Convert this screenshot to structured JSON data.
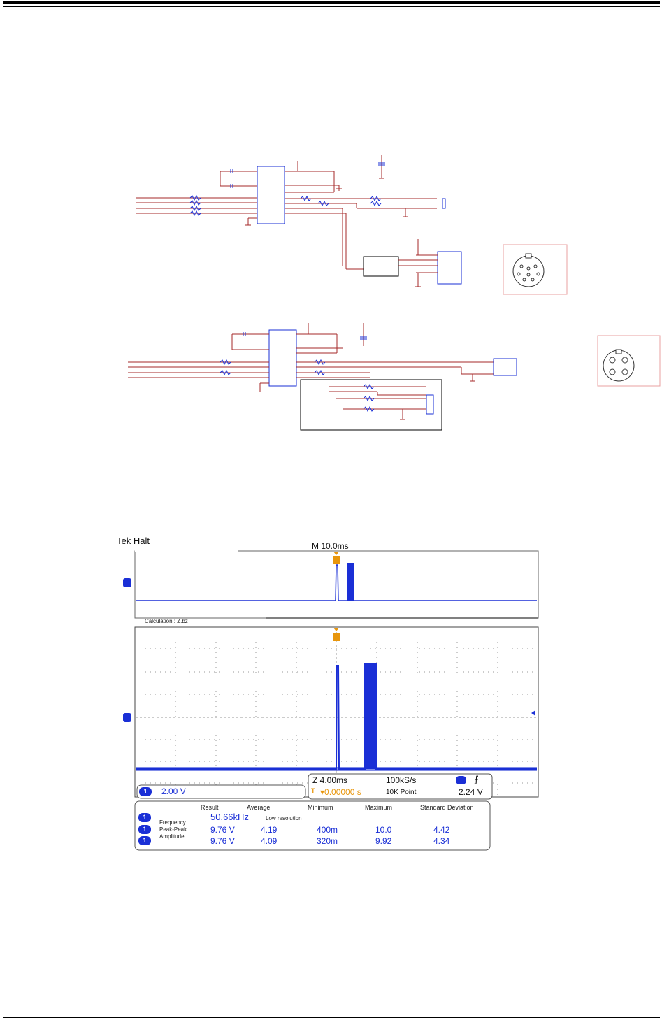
{
  "scope": {
    "brand_status": "Tek Halt",
    "main_timebase": "M 10.0ms",
    "calculation_label": "Calculation : Z.bz",
    "channel_marker": "1",
    "trigger_marker": "T",
    "zoom_timebase": "Z 4.00ms",
    "sample_rate": "100kS/s",
    "trigger_position": "▾0.00000 s",
    "record_length": "10K Point",
    "trigger_level": "2.24 V",
    "trigger_slope_icon": "rising-edge-icon",
    "channel_scale": "2.00 V",
    "colors": {
      "trace": "#1a2fd6",
      "trigger": "#e8960c",
      "schematic": "#b22222"
    }
  },
  "measurements": {
    "headers": [
      "Result",
      "Average",
      "Minimum",
      "Maximum",
      "Standard Deviation"
    ],
    "rows": [
      {
        "name": "Frequency",
        "result": "50.66kHz",
        "note": "Low resolution",
        "average": "",
        "minimum": "",
        "maximum": "",
        "stddev": ""
      },
      {
        "name": "Peak-Peak",
        "result": "9.76 V",
        "note": "",
        "average": "4.19",
        "minimum": "400m",
        "maximum": "10.0",
        "stddev": "4.42"
      },
      {
        "name": "Amplitude",
        "result": "9.76 V",
        "note": "",
        "average": "4.09",
        "minimum": "320m",
        "maximum": "9.92",
        "stddev": "4.34"
      }
    ]
  }
}
